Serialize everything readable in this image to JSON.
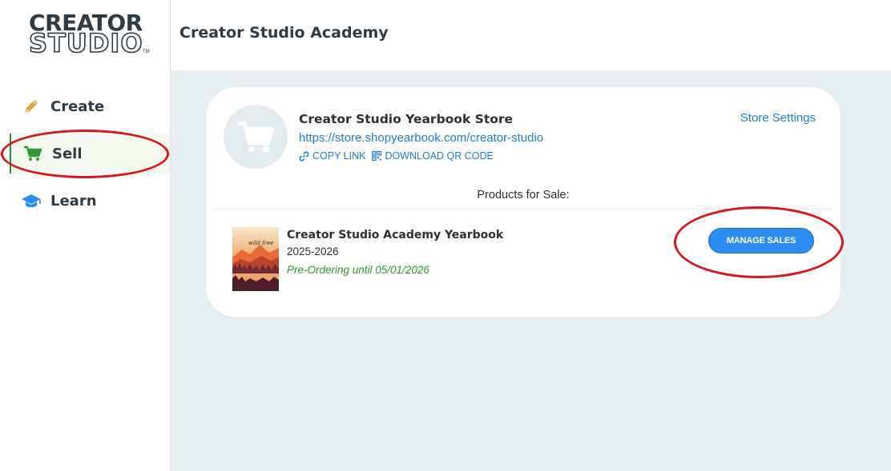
{
  "sidebar": {
    "logo": {
      "line1": "CREATOR",
      "line2": "STUDIO",
      "tm": "TM"
    },
    "items": [
      {
        "label": "Create",
        "icon": "pencil-icon"
      },
      {
        "label": "Sell",
        "icon": "cart-icon",
        "active": true
      },
      {
        "label": "Learn",
        "icon": "graduation-cap-icon"
      }
    ]
  },
  "header": {
    "title": "Creator Studio Academy"
  },
  "store": {
    "name": "Creator Studio Yearbook Store",
    "url": "https://store.shopyearbook.com/creator-studio",
    "copy_link": "COPY LINK",
    "download_qr": "DOWNLOAD QR CODE",
    "settings": "Store Settings",
    "products_label": "Products for Sale:"
  },
  "product": {
    "name": "Creator Studio Academy Yearbook",
    "year": "2025-2026",
    "status": "Pre-Ordering until 05/01/2026",
    "cover_text": "wild free",
    "manage_label": "MANAGE SALES"
  },
  "colors": {
    "accent": "#1a7fd8",
    "button": "#2b8ef0",
    "active_green": "#2d8f36",
    "status_green": "#2b9a2b",
    "annotation_red": "#d8161b"
  }
}
